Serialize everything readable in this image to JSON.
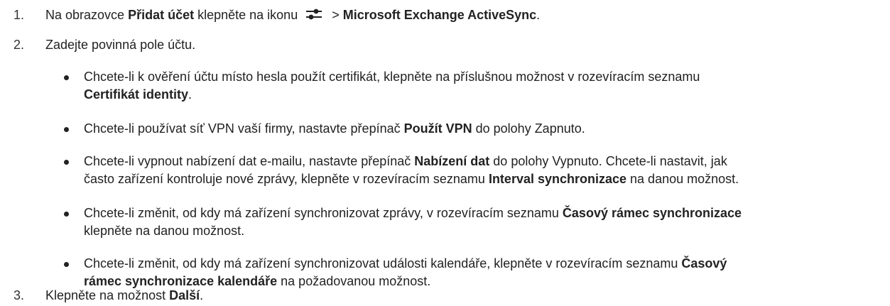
{
  "steps": [
    {
      "num": "1.",
      "pre": "Na obrazovce ",
      "bold1": "Přidat účet",
      "mid": " klepněte na ikonu ",
      "icon": "settings-sliders-icon",
      "sep": " > ",
      "bold2": "Microsoft Exchange ActiveSync",
      "post": "."
    },
    {
      "num": "2.",
      "text": "Zadejte povinná pole účtu."
    },
    {
      "num": "3.",
      "pre": "Klepněte na možnost ",
      "bold": "Další",
      "post": "."
    }
  ],
  "bullets": [
    {
      "line1": "Chcete-li k ověření účtu místo hesla použít certifikát, klepněte na příslušnou možnost v rozevíracím seznamu",
      "bold": "Certifikát identity",
      "post": "."
    },
    {
      "pre": "Chcete-li používat síť VPN vaší firmy, nastavte přepínač ",
      "bold": "Použít VPN",
      "post": " do polohy Zapnuto."
    },
    {
      "pre": "Chcete-li vypnout nabízení dat e-mailu, nastavte přepínač ",
      "bold1": "Nabízení dat",
      "mid": " do polohy Vypnuto. Chcete-li nastavit, jak",
      "line2pre": "často zařízení kontroluje nové zprávy, klepněte v rozevíracím seznamu ",
      "bold2": "Interval synchronizace",
      "post": " na danou možnost."
    },
    {
      "pre": "Chcete-li změnit, od kdy má zařízení synchronizovat zprávy, v rozevíracím seznamu ",
      "bold": "Časový rámec synchronizace",
      "line2": "klepněte na danou možnost."
    },
    {
      "pre": "Chcete-li změnit, od kdy má zařízení synchronizovat události kalendáře, klepněte v rozevíracím seznamu ",
      "bold1": "Časový",
      "bold2": "rámec synchronizace kalendáře",
      "post": " na požadovanou možnost."
    }
  ]
}
